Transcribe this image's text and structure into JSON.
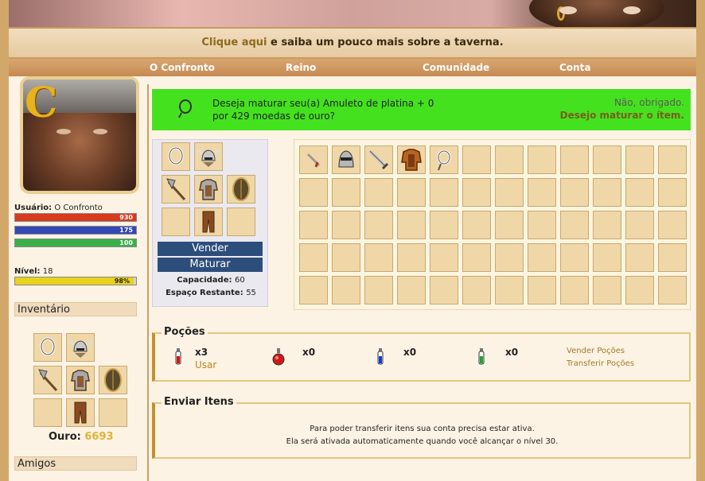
{
  "notice": {
    "link": "Clique aqui",
    "rest": " e saiba um pouco mais sobre a taverna."
  },
  "nav": [
    "O Confronto",
    "Reino",
    "Comunidade",
    "Conta"
  ],
  "sidebar": {
    "user_label": "Usuário:",
    "user_name": "O Confronto",
    "bars": [
      {
        "value": "930",
        "color": "#d83a1e"
      },
      {
        "value": "175",
        "color": "#3448b5"
      },
      {
        "value": "100",
        "color": "#3bb04a"
      }
    ],
    "level_label": "Nível:",
    "level_value": "18",
    "xp": {
      "value": "98%",
      "fraction": 0.98,
      "color": "#e8d21b"
    },
    "inventory_title": "Inventário",
    "gold_label": "Ouro:",
    "gold_value": "6693",
    "friends_title": "Amigos"
  },
  "alert": {
    "line1": "Deseja maturar seu(a) Amuleto de platina + 0",
    "line2": "por 429 moedas de ouro?",
    "decline": "Não, obrigado.",
    "accept": "Desejo maturar o ítem."
  },
  "equip": {
    "sell": "Vender",
    "mature": "Maturar",
    "capacity_label": "Capacidade:",
    "capacity_value": "60",
    "remaining_label": "Espaço Restante:",
    "remaining_value": "55"
  },
  "potions": {
    "title": "Poções",
    "items": [
      {
        "icon": "red-vial-icon",
        "count": "x3",
        "use": "Usar"
      },
      {
        "icon": "red-flask-icon",
        "count": "x0"
      },
      {
        "icon": "blue-vial-icon",
        "count": "x0"
      },
      {
        "icon": "green-vial-icon",
        "count": "x0"
      }
    ],
    "sell_link": "Vender Poções",
    "transfer_link": "Transferir Poções"
  },
  "send": {
    "title": "Enviar Itens",
    "line1": "Para poder transferir itens sua conta precisa estar ativa.",
    "line2": "Ela será ativada automaticamente quando você alcançar o nível 30."
  }
}
